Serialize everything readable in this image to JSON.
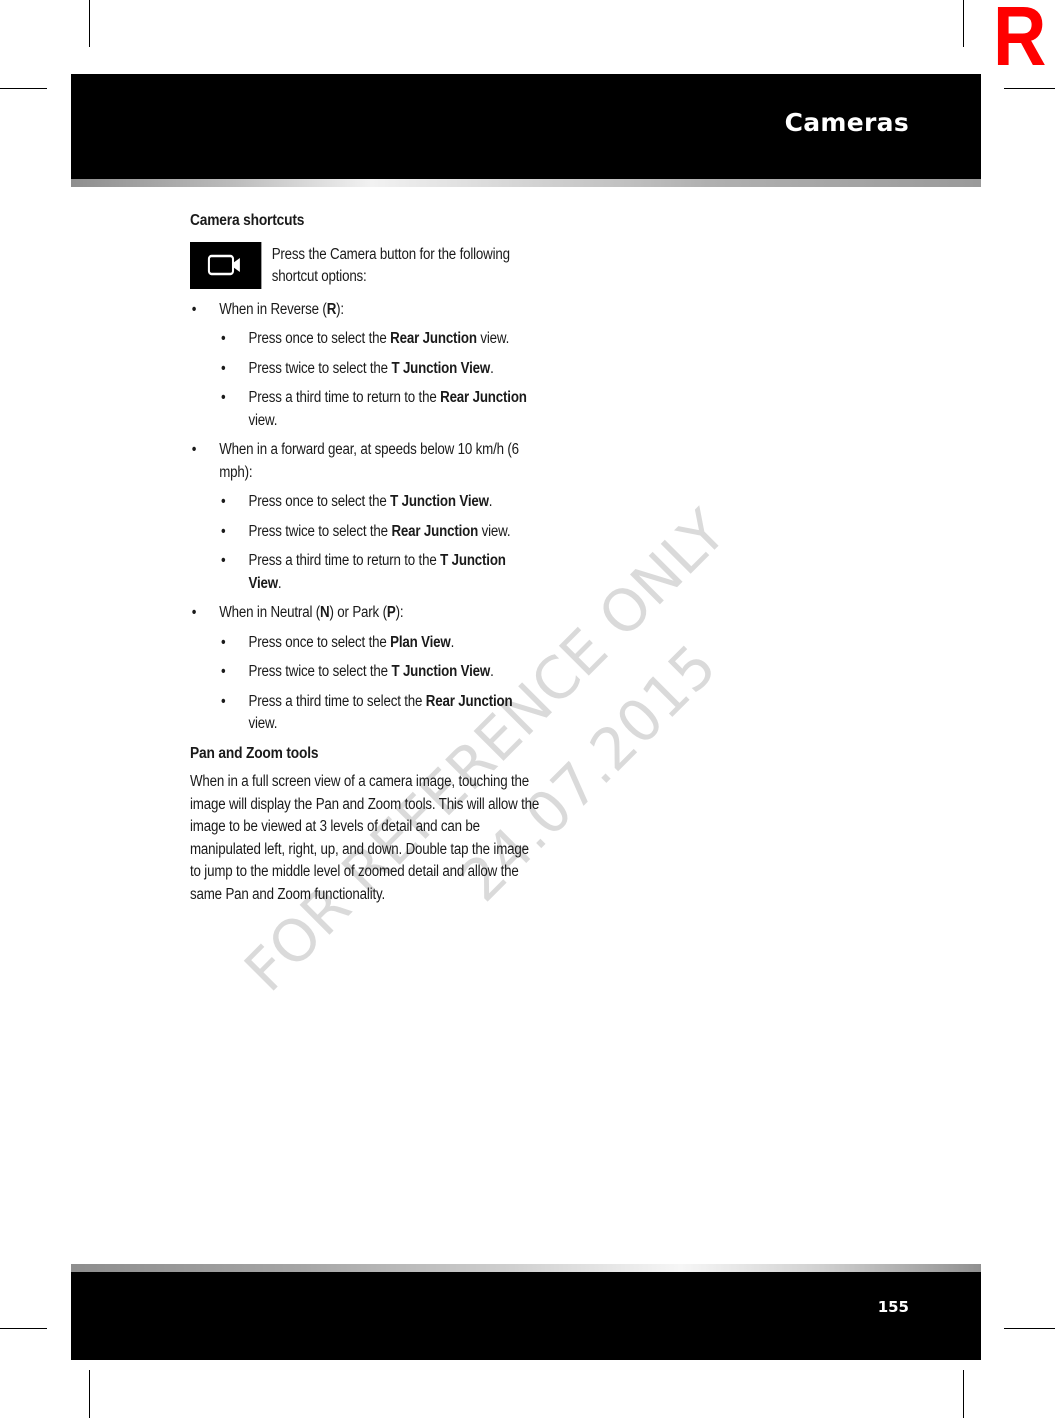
{
  "registration_mark": "R",
  "header": {
    "title": "Cameras"
  },
  "footer": {
    "page_number": "155"
  },
  "camera_shortcuts": {
    "heading": "Camera shortcuts",
    "icon": "video-camera-icon",
    "intro": "Press the Camera button for the following shortcut options:",
    "groups": [
      {
        "condition_prefix": "When in Reverse (",
        "condition_bold": "R",
        "condition_suffix": "):",
        "items": [
          {
            "pre": "Press once to select the ",
            "bold": "Rear Junction",
            "post": " view."
          },
          {
            "pre": "Press twice to select the ",
            "bold": "T Junction View",
            "post": "."
          },
          {
            "pre": "Press a third time to return to the ",
            "bold": "Rear Junction",
            "post": " view."
          }
        ]
      },
      {
        "condition_prefix": "When in a forward gear, at speeds below 10 km/h (6 mph):",
        "items": [
          {
            "pre": "Press once to select the ",
            "bold": "T Junction View",
            "post": "."
          },
          {
            "pre": "Press twice to select the ",
            "bold": "Rear Junction",
            "post": " view."
          },
          {
            "pre": "Press a third time to return to the ",
            "bold": "T Junction View",
            "post": "."
          }
        ]
      },
      {
        "condition_prefix": "When in Neutral (",
        "condition_bold": "N",
        "condition_middle": ") or Park (",
        "condition_bold2": "P",
        "condition_suffix": "):",
        "items": [
          {
            "pre": "Press once to select the ",
            "bold": "Plan View",
            "post": "."
          },
          {
            "pre": "Press twice to select the ",
            "bold": "T Junction View",
            "post": "."
          },
          {
            "pre": "Press a third time to select the ",
            "bold": "Rear Junction",
            "post": " view."
          }
        ]
      }
    ]
  },
  "pan_zoom": {
    "heading": "Pan and Zoom tools",
    "body": "When in a full screen view of a camera image, touching the image will display the Pan and Zoom tools. This will allow the image to be viewed at 3 levels of detail and can be manipulated left, right, up, and down. Double tap the image to jump to the middle level of zoomed detail and allow the same Pan and Zoom functionality."
  },
  "watermark": {
    "line1": "FOR REFERENCE ONLY",
    "line2": "24.07.2015"
  },
  "bullet_glyph": "•"
}
